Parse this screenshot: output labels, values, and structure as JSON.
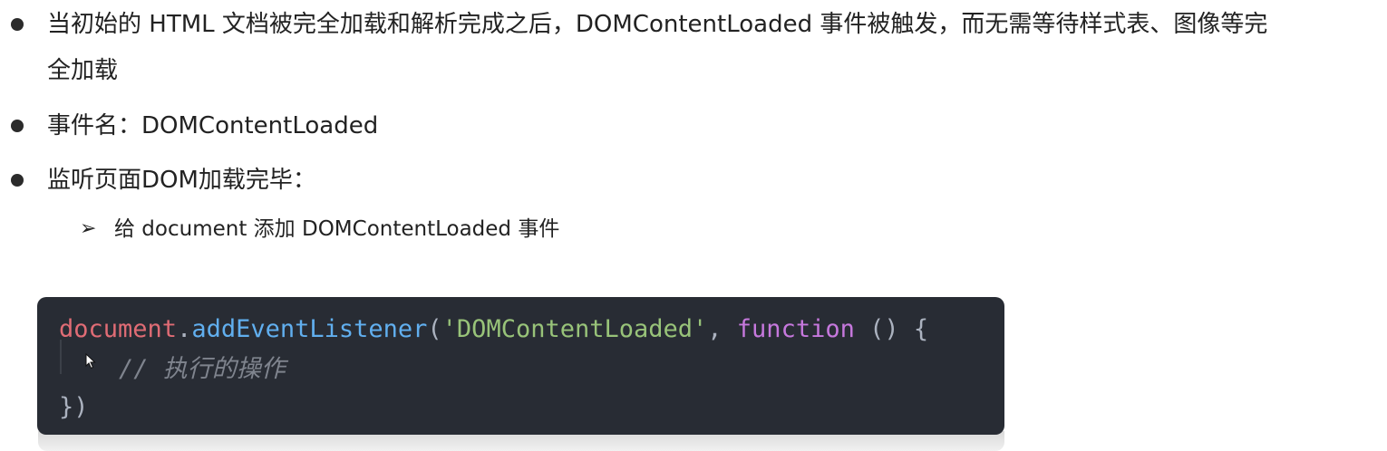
{
  "bullets": [
    {
      "line1": "当初始的 HTML 文档被完全加载和解析完成之后，DOMContentLoaded 事件被触发，而无需等待样式表、图像等完",
      "line2": "全加载"
    },
    {
      "text": "事件名：DOMContentLoaded"
    },
    {
      "text": "监听页面DOM加载完毕："
    }
  ],
  "sub_bullet": {
    "arrow": "➢",
    "text": "给 document 添加 DOMContentLoaded 事件"
  },
  "code": {
    "line1": {
      "obj": "document",
      "dot": ".",
      "method": "addEventListener",
      "open_paren": "(",
      "string": "'DOMContentLoaded'",
      "comma": ", ",
      "keyword": "function",
      "rest": " () {"
    },
    "line2": {
      "comment": "// 执行的操作"
    },
    "line3": {
      "close": "})"
    }
  },
  "icons": {
    "cursor": "mouse-pointer-icon"
  },
  "colors": {
    "code_background": "#282c34",
    "variable": "#e06c75",
    "function": "#61afef",
    "string": "#98c379",
    "keyword": "#c678dd",
    "comment": "#7f848e"
  }
}
